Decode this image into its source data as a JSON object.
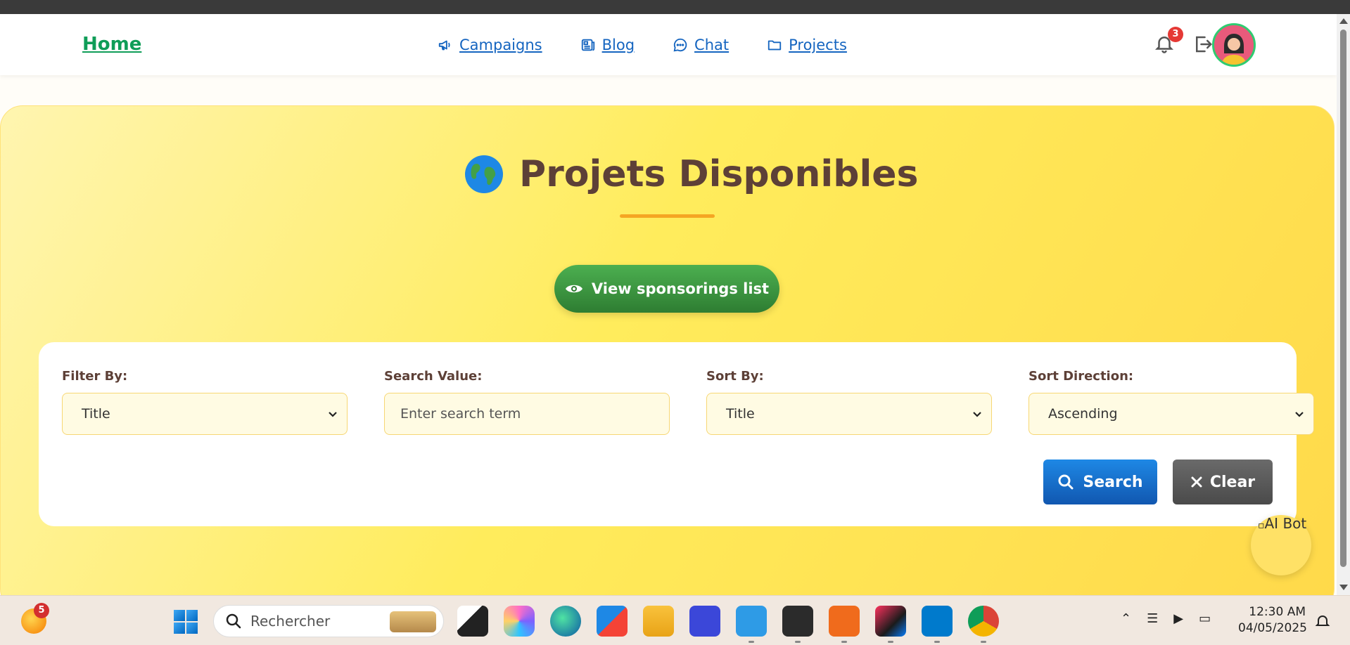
{
  "navbar": {
    "home": "Home",
    "links": [
      {
        "label": "Campaigns",
        "icon": "megaphone-icon"
      },
      {
        "label": "Blog",
        "icon": "newspaper-icon"
      },
      {
        "label": "Chat",
        "icon": "chat-bubble-icon"
      },
      {
        "label": "Projects",
        "icon": "folder-icon"
      }
    ],
    "notification_count": "3"
  },
  "hero": {
    "title": "Projets Disponibles",
    "sponsor_button": "View sponsorings list"
  },
  "filters": {
    "filter_by_label": "Filter By:",
    "filter_by_value": "Title",
    "search_value_label": "Search Value:",
    "search_placeholder": "Enter search term",
    "sort_by_label": "Sort By:",
    "sort_by_value": "Title",
    "sort_direction_label": "Sort Direction:",
    "sort_direction_value": "Ascending",
    "search_button": "Search",
    "clear_button": "Clear"
  },
  "ai_bot_alt": "AI Bot",
  "taskbar": {
    "weather_badge": "5",
    "search_placeholder": "Rechercher",
    "time": "12:30 AM",
    "date": "04/05/2025"
  },
  "colors": {
    "home": "#0f9d58",
    "nav_link": "#1565c0",
    "title": "#5d4037",
    "accent_underline": "#f5a623",
    "sponsor_button": "#2e7d32",
    "search_button": "#1565c0",
    "clear_button": "#555555"
  }
}
